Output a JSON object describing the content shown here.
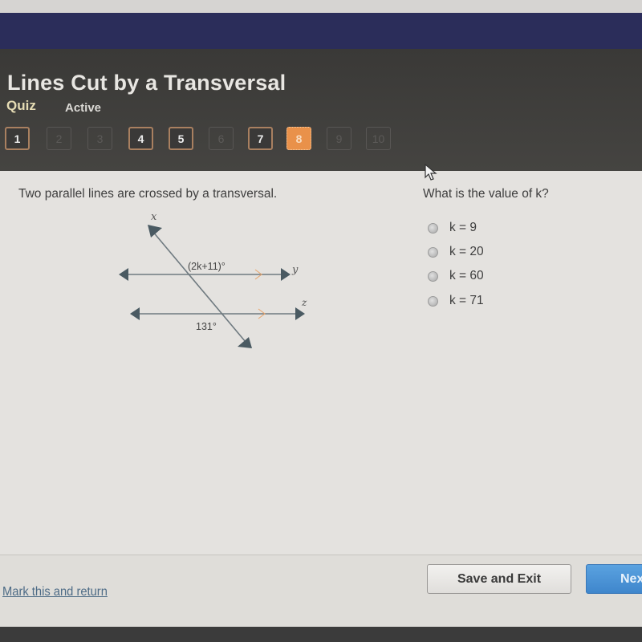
{
  "header": {
    "title": "Lines Cut by a Transversal",
    "quiz_label": "Quiz",
    "status": "Active"
  },
  "question_nav": [
    {
      "label": "1",
      "state": "answered"
    },
    {
      "label": "2",
      "state": "disabled"
    },
    {
      "label": "3",
      "state": "disabled"
    },
    {
      "label": "4",
      "state": "answered"
    },
    {
      "label": "5",
      "state": "answered"
    },
    {
      "label": "6",
      "state": "disabled"
    },
    {
      "label": "7",
      "state": "answered"
    },
    {
      "label": "8",
      "state": "current"
    },
    {
      "label": "9",
      "state": "disabled"
    },
    {
      "label": "10",
      "state": "disabled"
    }
  ],
  "problem": {
    "prompt": "Two parallel lines are crossed by a transversal.",
    "question": "What is the value of k?",
    "diagram": {
      "transversal_label": "x",
      "line1_label": "y",
      "line2_label": "z",
      "angle_top": "(2k+11)°",
      "angle_bottom": "131°"
    },
    "options": [
      {
        "label": "k = 9",
        "selected": false
      },
      {
        "label": "k = 20",
        "selected": false
      },
      {
        "label": "k = 60",
        "selected": false
      },
      {
        "label": "k = 71",
        "selected": false
      }
    ]
  },
  "footer": {
    "mark_link": "Mark this and return",
    "save_exit": "Save and Exit",
    "next": "Next"
  },
  "colors": {
    "brand_bar": "#2b2d5a",
    "header_bg": "#3f3e3c",
    "current_question": "#e9914a",
    "next_button": "#4a92d4",
    "parallel_mark": "#e9a46a"
  }
}
